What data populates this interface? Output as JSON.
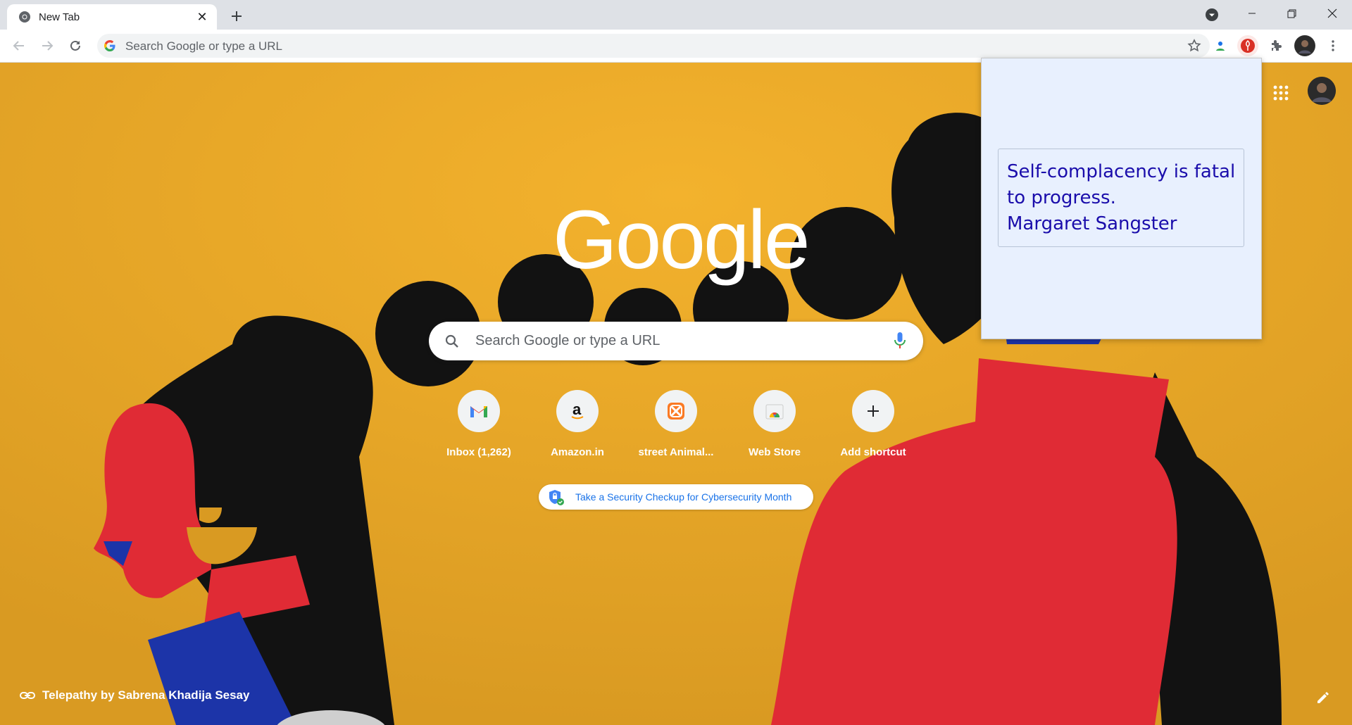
{
  "tab": {
    "title": "New Tab",
    "close_symbol": "✕"
  },
  "toolbar": {
    "omnibox_placeholder": "Search Google or type a URL"
  },
  "ntp": {
    "logo": "Google",
    "search_placeholder": "Search Google or type a URL",
    "shortcuts": [
      {
        "label": "Inbox (1,262)",
        "icon": "gmail-icon"
      },
      {
        "label": "Amazon.in",
        "icon": "amazon-icon"
      },
      {
        "label": "street Animal...",
        "icon": "xampp-icon"
      },
      {
        "label": "Web Store",
        "icon": "webstore-icon"
      },
      {
        "label": "Add shortcut",
        "icon": "plus-icon"
      }
    ],
    "promo_text": "Take a Security Checkup for Cybersecurity Month",
    "attribution": "Telepathy by Sabrena Khadija Sesay"
  },
  "popup": {
    "quote_line1": "Self-complacency is fatal to progress.",
    "quote_author": "Margaret Sangster"
  },
  "colors": {
    "wallpaper": "#e2a52a",
    "popup_bg": "#e8f0fe",
    "quote_text": "#1a0dab",
    "figure_red": "#e02b35",
    "figure_blue": "#1c34a8",
    "figure_black": "#121212"
  }
}
